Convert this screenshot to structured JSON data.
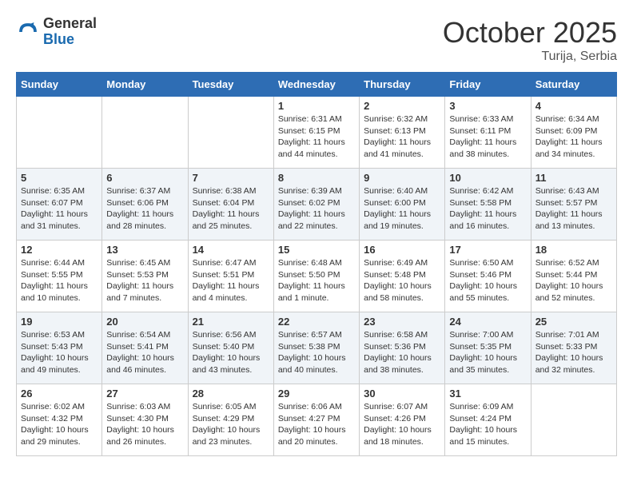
{
  "logo": {
    "general": "General",
    "blue": "Blue"
  },
  "title": "October 2025",
  "subtitle": "Turija, Serbia",
  "days_header": [
    "Sunday",
    "Monday",
    "Tuesday",
    "Wednesday",
    "Thursday",
    "Friday",
    "Saturday"
  ],
  "weeks": [
    [
      {
        "day": "",
        "info": ""
      },
      {
        "day": "",
        "info": ""
      },
      {
        "day": "",
        "info": ""
      },
      {
        "day": "1",
        "info": "Sunrise: 6:31 AM\nSunset: 6:15 PM\nDaylight: 11 hours\nand 44 minutes."
      },
      {
        "day": "2",
        "info": "Sunrise: 6:32 AM\nSunset: 6:13 PM\nDaylight: 11 hours\nand 41 minutes."
      },
      {
        "day": "3",
        "info": "Sunrise: 6:33 AM\nSunset: 6:11 PM\nDaylight: 11 hours\nand 38 minutes."
      },
      {
        "day": "4",
        "info": "Sunrise: 6:34 AM\nSunset: 6:09 PM\nDaylight: 11 hours\nand 34 minutes."
      }
    ],
    [
      {
        "day": "5",
        "info": "Sunrise: 6:35 AM\nSunset: 6:07 PM\nDaylight: 11 hours\nand 31 minutes."
      },
      {
        "day": "6",
        "info": "Sunrise: 6:37 AM\nSunset: 6:06 PM\nDaylight: 11 hours\nand 28 minutes."
      },
      {
        "day": "7",
        "info": "Sunrise: 6:38 AM\nSunset: 6:04 PM\nDaylight: 11 hours\nand 25 minutes."
      },
      {
        "day": "8",
        "info": "Sunrise: 6:39 AM\nSunset: 6:02 PM\nDaylight: 11 hours\nand 22 minutes."
      },
      {
        "day": "9",
        "info": "Sunrise: 6:40 AM\nSunset: 6:00 PM\nDaylight: 11 hours\nand 19 minutes."
      },
      {
        "day": "10",
        "info": "Sunrise: 6:42 AM\nSunset: 5:58 PM\nDaylight: 11 hours\nand 16 minutes."
      },
      {
        "day": "11",
        "info": "Sunrise: 6:43 AM\nSunset: 5:57 PM\nDaylight: 11 hours\nand 13 minutes."
      }
    ],
    [
      {
        "day": "12",
        "info": "Sunrise: 6:44 AM\nSunset: 5:55 PM\nDaylight: 11 hours\nand 10 minutes."
      },
      {
        "day": "13",
        "info": "Sunrise: 6:45 AM\nSunset: 5:53 PM\nDaylight: 11 hours\nand 7 minutes."
      },
      {
        "day": "14",
        "info": "Sunrise: 6:47 AM\nSunset: 5:51 PM\nDaylight: 11 hours\nand 4 minutes."
      },
      {
        "day": "15",
        "info": "Sunrise: 6:48 AM\nSunset: 5:50 PM\nDaylight: 11 hours\nand 1 minute."
      },
      {
        "day": "16",
        "info": "Sunrise: 6:49 AM\nSunset: 5:48 PM\nDaylight: 10 hours\nand 58 minutes."
      },
      {
        "day": "17",
        "info": "Sunrise: 6:50 AM\nSunset: 5:46 PM\nDaylight: 10 hours\nand 55 minutes."
      },
      {
        "day": "18",
        "info": "Sunrise: 6:52 AM\nSunset: 5:44 PM\nDaylight: 10 hours\nand 52 minutes."
      }
    ],
    [
      {
        "day": "19",
        "info": "Sunrise: 6:53 AM\nSunset: 5:43 PM\nDaylight: 10 hours\nand 49 minutes."
      },
      {
        "day": "20",
        "info": "Sunrise: 6:54 AM\nSunset: 5:41 PM\nDaylight: 10 hours\nand 46 minutes."
      },
      {
        "day": "21",
        "info": "Sunrise: 6:56 AM\nSunset: 5:40 PM\nDaylight: 10 hours\nand 43 minutes."
      },
      {
        "day": "22",
        "info": "Sunrise: 6:57 AM\nSunset: 5:38 PM\nDaylight: 10 hours\nand 40 minutes."
      },
      {
        "day": "23",
        "info": "Sunrise: 6:58 AM\nSunset: 5:36 PM\nDaylight: 10 hours\nand 38 minutes."
      },
      {
        "day": "24",
        "info": "Sunrise: 7:00 AM\nSunset: 5:35 PM\nDaylight: 10 hours\nand 35 minutes."
      },
      {
        "day": "25",
        "info": "Sunrise: 7:01 AM\nSunset: 5:33 PM\nDaylight: 10 hours\nand 32 minutes."
      }
    ],
    [
      {
        "day": "26",
        "info": "Sunrise: 6:02 AM\nSunset: 4:32 PM\nDaylight: 10 hours\nand 29 minutes."
      },
      {
        "day": "27",
        "info": "Sunrise: 6:03 AM\nSunset: 4:30 PM\nDaylight: 10 hours\nand 26 minutes."
      },
      {
        "day": "28",
        "info": "Sunrise: 6:05 AM\nSunset: 4:29 PM\nDaylight: 10 hours\nand 23 minutes."
      },
      {
        "day": "29",
        "info": "Sunrise: 6:06 AM\nSunset: 4:27 PM\nDaylight: 10 hours\nand 20 minutes."
      },
      {
        "day": "30",
        "info": "Sunrise: 6:07 AM\nSunset: 4:26 PM\nDaylight: 10 hours\nand 18 minutes."
      },
      {
        "day": "31",
        "info": "Sunrise: 6:09 AM\nSunset: 4:24 PM\nDaylight: 10 hours\nand 15 minutes."
      },
      {
        "day": "",
        "info": ""
      }
    ]
  ]
}
